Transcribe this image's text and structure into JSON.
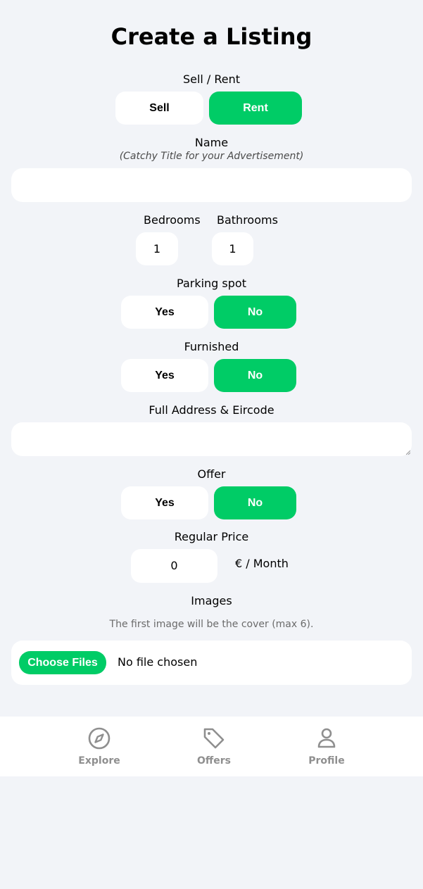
{
  "page": {
    "title": "Create a Listing"
  },
  "type_section": {
    "label": "Sell / Rent",
    "sell_label": "Sell",
    "rent_label": "Rent",
    "selected": "Rent"
  },
  "name_section": {
    "label": "Name",
    "hint": "(Catchy Title for your Advertisement)",
    "value": ""
  },
  "rooms": {
    "bedrooms_label": "Bedrooms",
    "bedrooms_value": "1",
    "bathrooms_label": "Bathrooms",
    "bathrooms_value": "1"
  },
  "parking": {
    "label": "Parking spot",
    "yes_label": "Yes",
    "no_label": "No",
    "selected": "No"
  },
  "furnished": {
    "label": "Furnished",
    "yes_label": "Yes",
    "no_label": "No",
    "selected": "No"
  },
  "address": {
    "label": "Full Address & Eircode",
    "value": ""
  },
  "offer": {
    "label": "Offer",
    "yes_label": "Yes",
    "no_label": "No",
    "selected": "No"
  },
  "price": {
    "label": "Regular Price",
    "value": "0",
    "suffix": "€ / Month"
  },
  "images": {
    "label": "Images",
    "note": "The first image will be the cover (max 6).",
    "choose_label": "Choose Files",
    "status": "No file chosen"
  },
  "nav": {
    "items": [
      {
        "label": "Explore",
        "icon": "compass-icon"
      },
      {
        "label": "Offers",
        "icon": "tag-icon"
      },
      {
        "label": "Profile",
        "icon": "person-icon"
      }
    ]
  },
  "colors": {
    "accent": "#00cc66",
    "background": "#f2f4f8",
    "nav_text": "#8f8f8f"
  }
}
